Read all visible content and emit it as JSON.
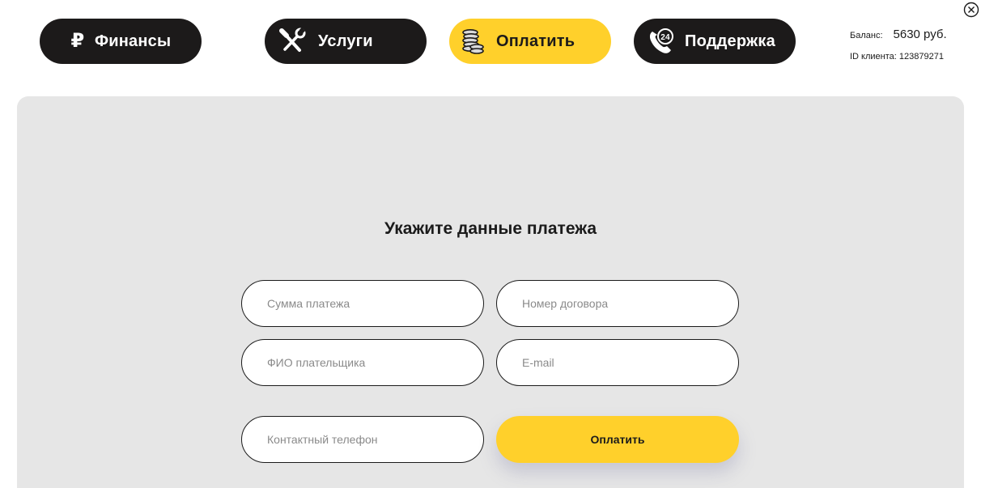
{
  "nav": {
    "finance": {
      "label": "Финансы",
      "icon": "ruble-icon",
      "glyph": "₽"
    },
    "services": {
      "label": "Услуги",
      "icon": "tools-icon"
    },
    "pay": {
      "label": "Оплатить",
      "icon": "coins-icon"
    },
    "support": {
      "label": "Поддержка",
      "icon": "phone-24-icon",
      "badge": "24"
    }
  },
  "account": {
    "balance_label": "Баланс:",
    "balance_value": "5630 руб.",
    "client_id_label": "ID клиента:",
    "client_id_value": "123879271"
  },
  "form": {
    "title": "Укажите данные платежа",
    "amount_placeholder": "Сумма платежа",
    "contract_placeholder": "Номер договора",
    "name_placeholder": "ФИО плательщика",
    "email_placeholder": "E-mail",
    "phone_placeholder": "Контактный телефон",
    "submit_label": "Оплатить"
  },
  "colors": {
    "accent": "#ffd02b",
    "dark": "#1c1a1a",
    "panel": "#e6e6e6"
  }
}
